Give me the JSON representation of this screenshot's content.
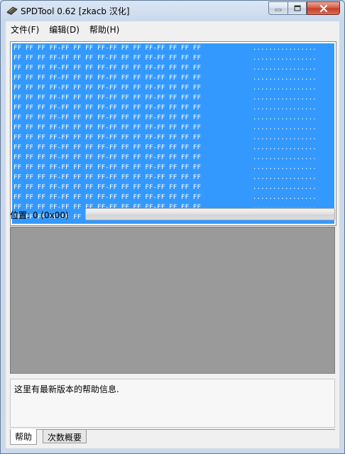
{
  "window": {
    "title": "SPDTool 0.62  [zkacb 汉化]"
  },
  "menu": {
    "items": [
      "文件(F)",
      "编辑(D)",
      "帮助(H)"
    ]
  },
  "hex": {
    "rows": [
      {
        "bytes": "FF FF FF FF-FF FF FF FF-FF FF FF FF-FF FF FF FF",
        "ascii": "................"
      },
      {
        "bytes": "FF FF FF FF-FF FF FF FF-FF FF FF FF-FF FF FF FF",
        "ascii": "................"
      },
      {
        "bytes": "FF FF FF FF-FF FF FF FF-FF FF FF FF-FF FF FF FF",
        "ascii": "................"
      },
      {
        "bytes": "FF FF FF FF-FF FF FF FF-FF FF FF FF-FF FF FF FF",
        "ascii": "................"
      },
      {
        "bytes": "FF FF FF FF-FF FF FF FF-FF FF FF FF-FF FF FF FF",
        "ascii": "................"
      },
      {
        "bytes": "FF FF FF FF-FF FF FF FF-FF FF FF FF-FF FF FF FF",
        "ascii": "................"
      },
      {
        "bytes": "FF FF FF FF-FF FF FF FF-FF FF FF FF-FF FF FF FF",
        "ascii": "................"
      },
      {
        "bytes": "FF FF FF FF-FF FF FF FF-FF FF FF FF-FF FF FF FF",
        "ascii": "................"
      },
      {
        "bytes": "FF FF FF FF-FF FF FF FF-FF FF FF FF-FF FF FF FF",
        "ascii": "................"
      },
      {
        "bytes": "FF FF FF FF-FF FF FF FF-FF FF FF FF-FF FF FF FF",
        "ascii": "................"
      },
      {
        "bytes": "FF FF FF FF-FF FF FF FF-FF FF FF FF-FF FF FF FF",
        "ascii": "................"
      },
      {
        "bytes": "FF FF FF FF-FF FF FF FF-FF FF FF FF-FF FF FF FF",
        "ascii": "................"
      },
      {
        "bytes": "FF FF FF FF-FF FF FF FF-FF FF FF FF-FF FF FF FF",
        "ascii": "................"
      },
      {
        "bytes": "FF FF FF FF-FF FF FF FF-FF FF FF FF-FF FF FF FF",
        "ascii": "................"
      },
      {
        "bytes": "FF FF FF FF-FF FF FF FF-FF FF FF FF-FF FF FF FF",
        "ascii": "................"
      },
      {
        "bytes": "FF FF FF FF-FF FF FF FF-FF FF FF FF-FF FF FF FF",
        "ascii": "................"
      },
      {
        "bytes": "FF FF FF FF-FF FF FF FF-FF FF FF FF-FF FF FF FF",
        "ascii": "................"
      },
      {
        "bytes": "FF FF FF FF-FF FF FF FF-FF FF FF FF-FF FF FF FF",
        "ascii": "................"
      }
    ],
    "selection_color": "#3399ff"
  },
  "status": {
    "position_label": "位置: 0 (0x00)",
    "progress": 0
  },
  "help": {
    "text": "这里有最新版本的帮助信息."
  },
  "tabs": [
    {
      "label": "帮助",
      "active": true
    },
    {
      "label": "次数概要",
      "active": false
    }
  ],
  "icons": {
    "app": "chip-icon",
    "minimize": "minimize-icon",
    "maximize": "maximize-icon",
    "close": "close-icon"
  }
}
